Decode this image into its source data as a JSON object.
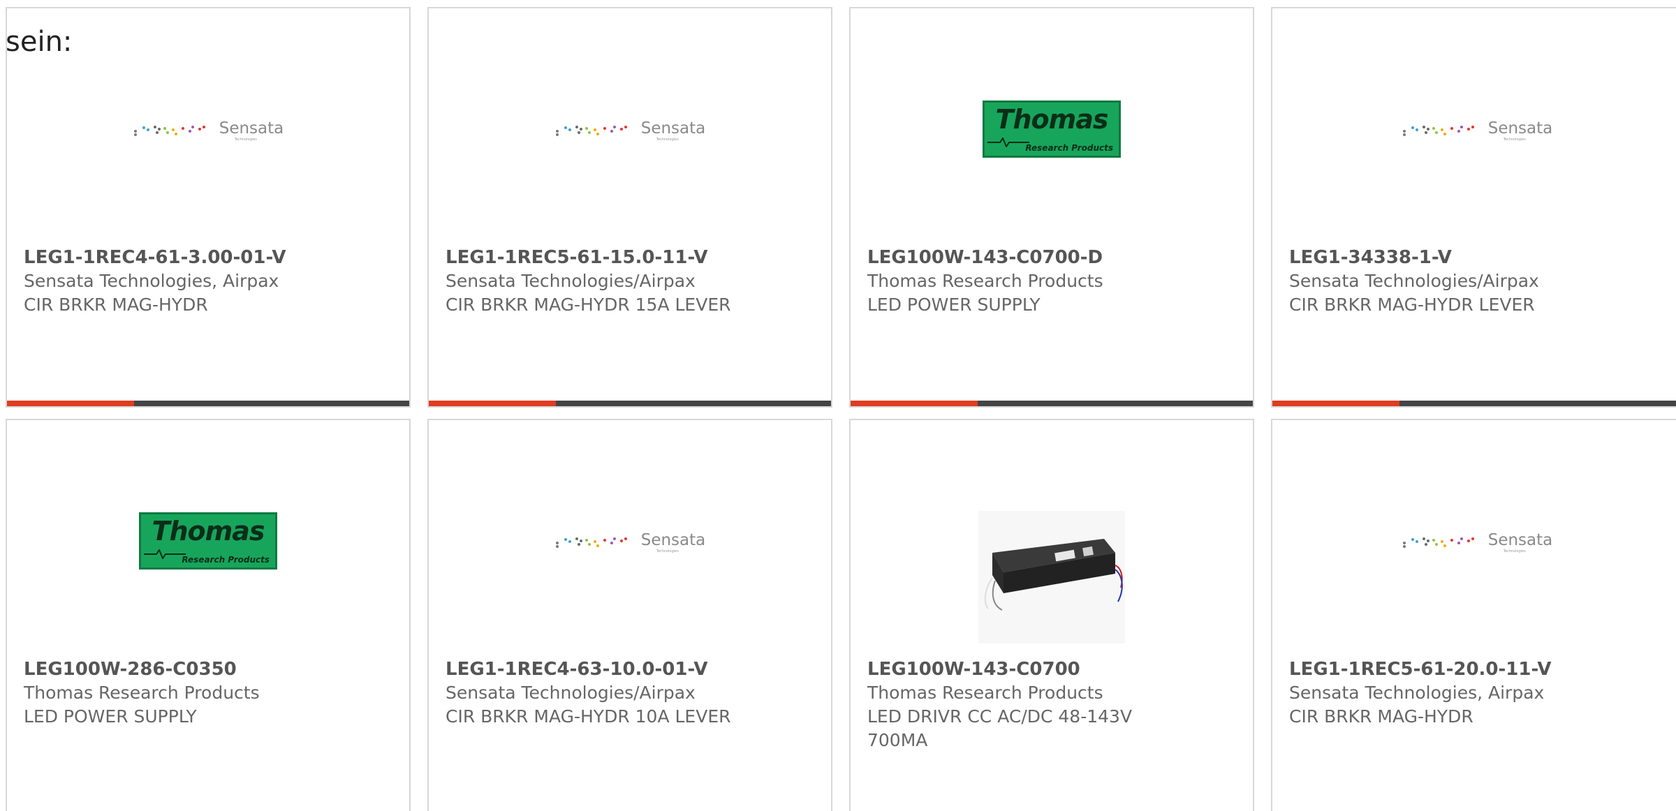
{
  "lead_text": "sein:",
  "logos": {
    "sensata": {
      "word": "Sensata",
      "sub": "Technologies"
    },
    "thomas": {
      "word": "Thomas",
      "sub": "Research Products"
    }
  },
  "colors": {
    "accent": "#e03c1f",
    "bar": "#444444",
    "thomas_green": "#17a55b"
  },
  "products": [
    {
      "part_number": "LEG1-1REC4-61-3.00-01-V",
      "manufacturer": "Sensata Technologies, Airpax",
      "description": "CIR BRKR MAG-HYDR",
      "image": "sensata-logo"
    },
    {
      "part_number": "LEG1-1REC5-61-15.0-11-V",
      "manufacturer": "Sensata Technologies/Airpax",
      "description": "CIR BRKR MAG-HYDR 15A LEVER",
      "image": "sensata-logo"
    },
    {
      "part_number": "LEG100W-143-C0700-D",
      "manufacturer": "Thomas Research Products",
      "description": "LED POWER SUPPLY",
      "image": "thomas-logo"
    },
    {
      "part_number": "LEG1-34338-1-V",
      "manufacturer": "Sensata Technologies/Airpax",
      "description": "CIR BRKR MAG-HYDR LEVER",
      "image": "sensata-logo"
    },
    {
      "part_number": "LEG100W-286-C0350",
      "manufacturer": "Thomas Research Products",
      "description": "LED POWER SUPPLY",
      "image": "thomas-logo"
    },
    {
      "part_number": "LEG1-1REC4-63-10.0-01-V",
      "manufacturer": "Sensata Technologies/Airpax",
      "description": "CIR BRKR MAG-HYDR 10A LEVER",
      "image": "sensata-logo"
    },
    {
      "part_number": "LEG100W-143-C0700",
      "manufacturer": "Thomas Research Products",
      "description": "LED DRIVR CC AC/DC 48-143V 700MA",
      "image": "led-driver-photo"
    },
    {
      "part_number": "LEG1-1REC5-61-20.0-11-V",
      "manufacturer": "Sensata Technologies, Airpax",
      "description": "CIR BRKR MAG-HYDR",
      "image": "sensata-logo"
    }
  ]
}
